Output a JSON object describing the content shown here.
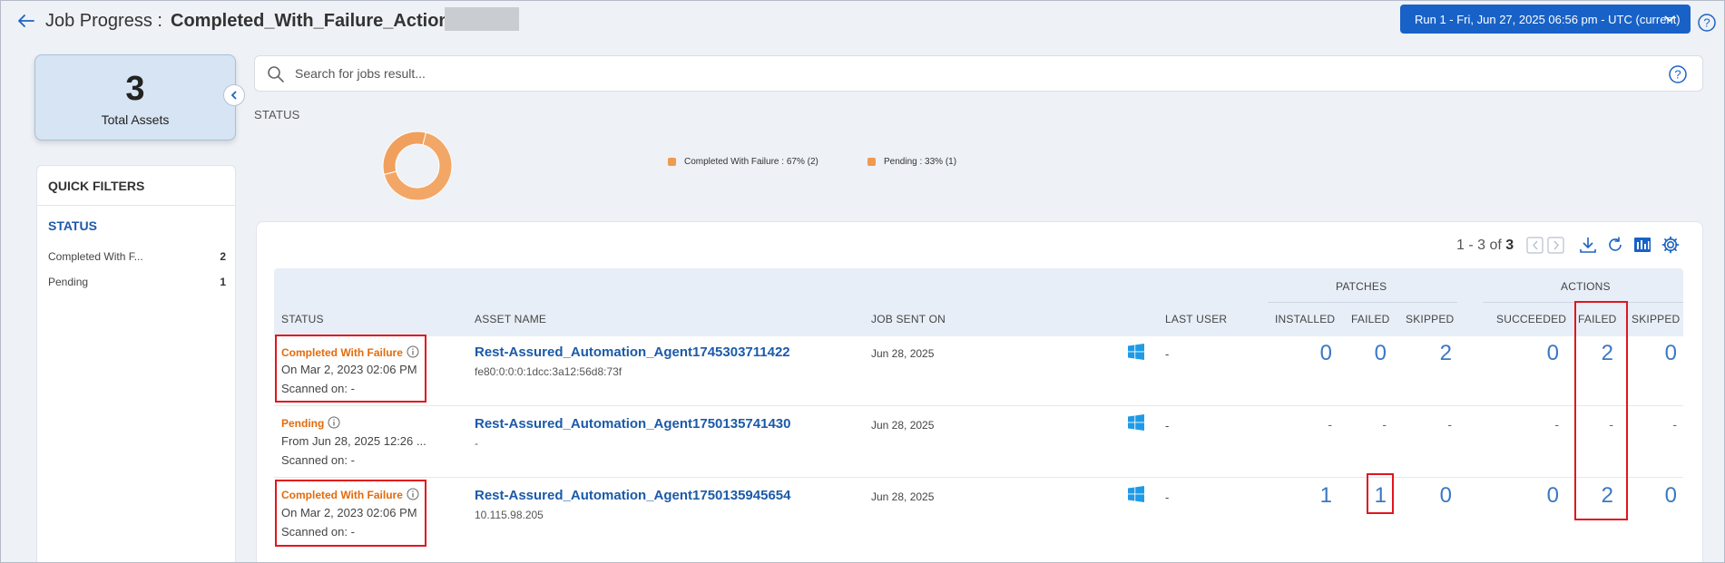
{
  "header": {
    "title_prefix": "Job Progress :",
    "title_name": "Completed_With_Failure_Actions_",
    "run_selector": "Run 1 - Fri, Jun 27, 2025 06:56 pm - UTC (current)"
  },
  "assets": {
    "count": "3",
    "label": "Total Assets"
  },
  "quick_filters": {
    "title": "QUICK FILTERS",
    "section": "STATUS",
    "items": [
      {
        "label": "Completed With F...",
        "count": "2"
      },
      {
        "label": "Pending",
        "count": "1"
      }
    ]
  },
  "search": {
    "placeholder": "Search for jobs result..."
  },
  "status_chart": {
    "title": "STATUS",
    "legend": [
      "Completed With Failure : 67% (2)",
      "Pending : 33% (1)"
    ]
  },
  "chart_data": {
    "type": "pie",
    "title": "STATUS",
    "slices": [
      {
        "label": "Completed With Failure",
        "percent": 67,
        "count": 2,
        "color": "#f3a766"
      },
      {
        "label": "Pending",
        "percent": 33,
        "count": 1,
        "color": "#f0a05c"
      }
    ]
  },
  "table": {
    "pager": {
      "range": "1 - 3 of",
      "total": "3"
    },
    "group_headers": {
      "patches": "PATCHES",
      "actions": "ACTIONS"
    },
    "columns": {
      "status": "STATUS",
      "asset_name": "ASSET NAME",
      "job_sent_on": "JOB SENT ON",
      "last_user": "LAST USER",
      "installed": "INSTALLED",
      "patch_failed": "FAILED",
      "patch_skipped": "SKIPPED",
      "succeeded": "SUCCEEDED",
      "action_failed": "FAILED",
      "action_skipped": "SKIPPED"
    },
    "rows": [
      {
        "status": "Completed With Failure",
        "status_date": "On Mar 2, 2023 02:06 PM",
        "scanned": "Scanned on: -",
        "asset_name": "Rest-Assured_Automation_Agent1745303711422",
        "asset_sub": "fe80:0:0:0:1dcc:3a12:56d8:73f",
        "job_sent_on": "Jun 28, 2025",
        "last_user": "-",
        "installed": "0",
        "patch_failed": "0",
        "patch_skipped": "2",
        "succeeded": "0",
        "action_failed": "2",
        "action_skipped": "0"
      },
      {
        "status": "Pending",
        "status_date": "From Jun 28, 2025 12:26 ...",
        "scanned": "Scanned on: -",
        "asset_name": "Rest-Assured_Automation_Agent1750135741430",
        "asset_sub": "-",
        "job_sent_on": "Jun 28, 2025",
        "last_user": "-",
        "installed": "-",
        "patch_failed": "-",
        "patch_skipped": "-",
        "succeeded": "-",
        "action_failed": "-",
        "action_skipped": "-"
      },
      {
        "status": "Completed With Failure",
        "status_date": "On Mar 2, 2023 02:06 PM",
        "scanned": "Scanned on: -",
        "asset_name": "Rest-Assured_Automation_Agent1750135945654",
        "asset_sub": "10.115.98.205",
        "job_sent_on": "Jun 28, 2025",
        "last_user": "-",
        "installed": "1",
        "patch_failed": "1",
        "patch_skipped": "0",
        "succeeded": "0",
        "action_failed": "2",
        "action_skipped": "0"
      }
    ]
  },
  "colors": {
    "accent": "#1862c7",
    "status_failure": "#e46b0c",
    "link": "#1b5aa8",
    "highlight": "#e0161e",
    "donut": "#f3a766"
  }
}
